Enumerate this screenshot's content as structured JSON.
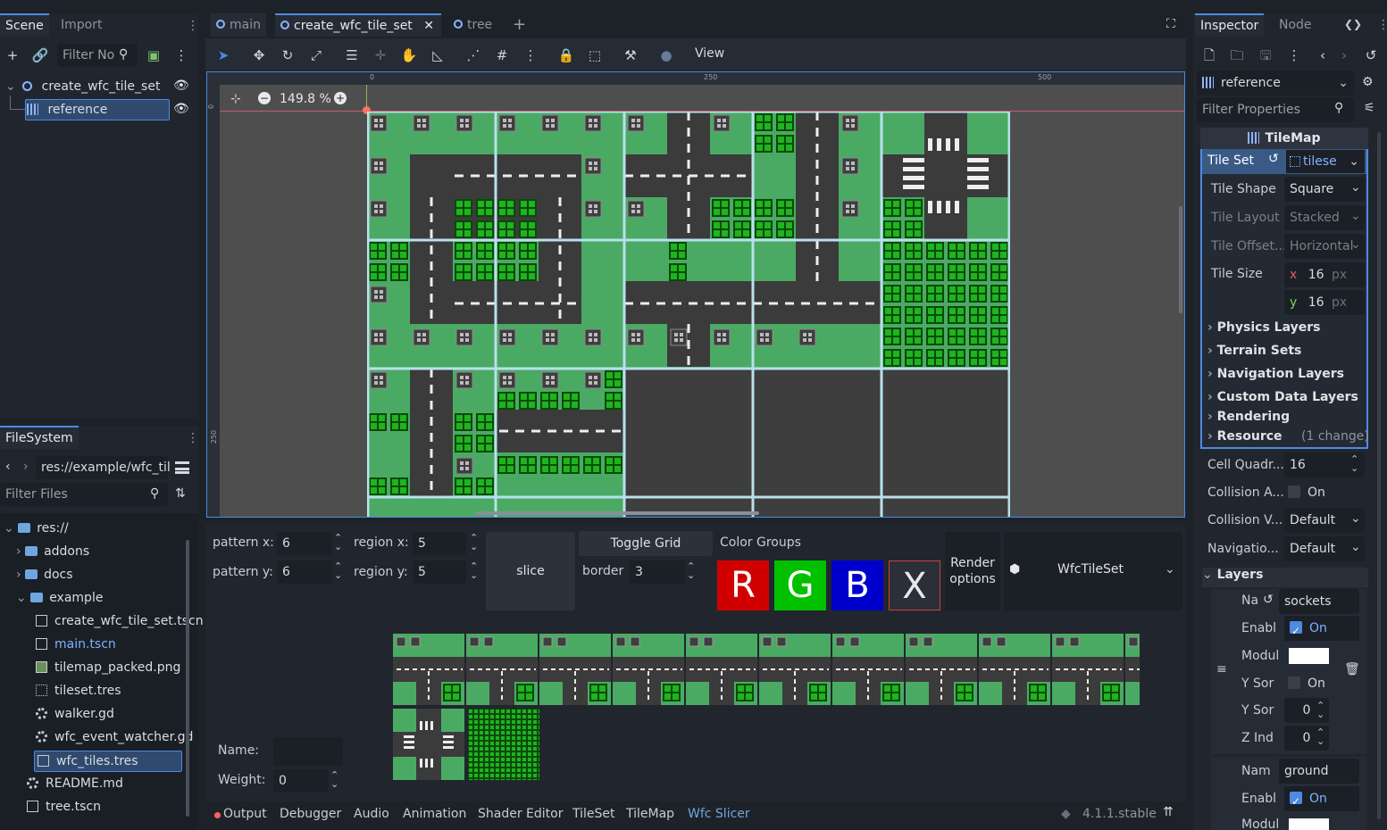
{
  "scene_dock": {
    "tabs": [
      "Scene",
      "Import"
    ],
    "filter_placeholder": "Filter No",
    "nodes": [
      {
        "label": "create_wfc_tile_set"
      },
      {
        "label": "reference"
      }
    ]
  },
  "filesystem": {
    "tab": "FileSystem",
    "path": "res://example/wfc_til",
    "filter_placeholder": "Filter Files",
    "items": [
      {
        "label": "res://"
      },
      {
        "label": "addons"
      },
      {
        "label": "docs"
      },
      {
        "label": "example"
      },
      {
        "label": "create_wfc_tile_set.tscn"
      },
      {
        "label": "main.tscn"
      },
      {
        "label": "tilemap_packed.png"
      },
      {
        "label": "tileset.tres"
      },
      {
        "label": "walker.gd"
      },
      {
        "label": "wfc_event_watcher.gd"
      },
      {
        "label": "wfc_tiles.tres"
      },
      {
        "label": "README.md"
      },
      {
        "label": "tree.tscn"
      }
    ]
  },
  "editor": {
    "tabs": [
      {
        "label": "main"
      },
      {
        "label": "create_wfc_tile_set"
      },
      {
        "label": "tree"
      }
    ],
    "toolbar_view": "View",
    "zoom": "149.8 %",
    "ruler": {
      "t0": "0",
      "t250": "250",
      "t500": "500",
      "v0": "0",
      "v250": "250"
    }
  },
  "slicer": {
    "pattern_x_label": "pattern x:",
    "pattern_x": "6",
    "pattern_y_label": "pattern y:",
    "pattern_y": "6",
    "region_x_label": "region x:",
    "region_x": "5",
    "region_y_label": "region y:",
    "region_y": "5",
    "slice": "slice",
    "toggle_grid": "Toggle Grid",
    "border_label": "border",
    "border": "3",
    "color_groups": "Color Groups",
    "color_buttons": [
      {
        "label": "R",
        "color": "#d10000"
      },
      {
        "label": "G",
        "color": "#00c000"
      },
      {
        "label": "B",
        "color": "#0000cc"
      },
      {
        "label": "X",
        "color": "#2a2f38"
      }
    ],
    "render_options_1": "Render",
    "render_options_2": "options",
    "resource_type": "WfcTileSet",
    "name_label": "Name:",
    "weight_label": "Weight:",
    "weight": "0"
  },
  "bottom_bar": {
    "tabs": [
      "Output",
      "Debugger",
      "Audio",
      "Animation",
      "Shader Editor",
      "TileSet",
      "TileMap",
      "Wfc Slicer"
    ],
    "version": "4.1.1.stable"
  },
  "inspector": {
    "tabs": [
      "Inspector",
      "Node"
    ],
    "object": "reference",
    "filter_placeholder": "Filter Properties",
    "class_header": "TileMap",
    "tile_set_label": "Tile Set",
    "tile_set_value": "tilese",
    "props": [
      {
        "label": "Tile Shape",
        "value": "Square"
      },
      {
        "label": "Tile Layout",
        "value": "Stacked"
      },
      {
        "label": "Tile Offset...",
        "value": "Horizontal"
      }
    ],
    "tile_size_label": "Tile Size",
    "tile_size_x": "16",
    "tile_size_y": "16",
    "px": "px",
    "x": "x",
    "y": "y",
    "sections": [
      "Physics Layers",
      "Terrain Sets",
      "Navigation Layers",
      "Custom Data Layers",
      "Rendering",
      "Resource"
    ],
    "resource_note": "(1 change)",
    "cell_quadrant_label": "Cell Quadr...",
    "cell_quadrant": "16",
    "collision_anim_label": "Collision A...",
    "collision_anim": "On",
    "collision_vis_label": "Collision V...",
    "collision_vis": "Default",
    "navigation_label": "Navigatio...",
    "navigation": "Default",
    "layers_label": "Layers",
    "layer0": {
      "name_label": "Na",
      "name": "sockets",
      "enabled_label": "Enabl",
      "enabled": "On",
      "modulate_label": "Modul",
      "ysort_label": "Y Sor",
      "ysort": "On",
      "ysort_origin_label": "Y Sor",
      "ysort_origin": "0",
      "zindex_label": "Z Ind",
      "zindex": "0"
    },
    "layer1": {
      "name_label": "Nam",
      "name": "ground",
      "enabled_label": "Enabl",
      "enabled": "On",
      "modulate_label": "Modul"
    }
  },
  "colors": {
    "accent": "#4d8ae0",
    "grass": "#4aaa64",
    "road": "#3b3b3b",
    "grid": "#b8e0ec"
  }
}
